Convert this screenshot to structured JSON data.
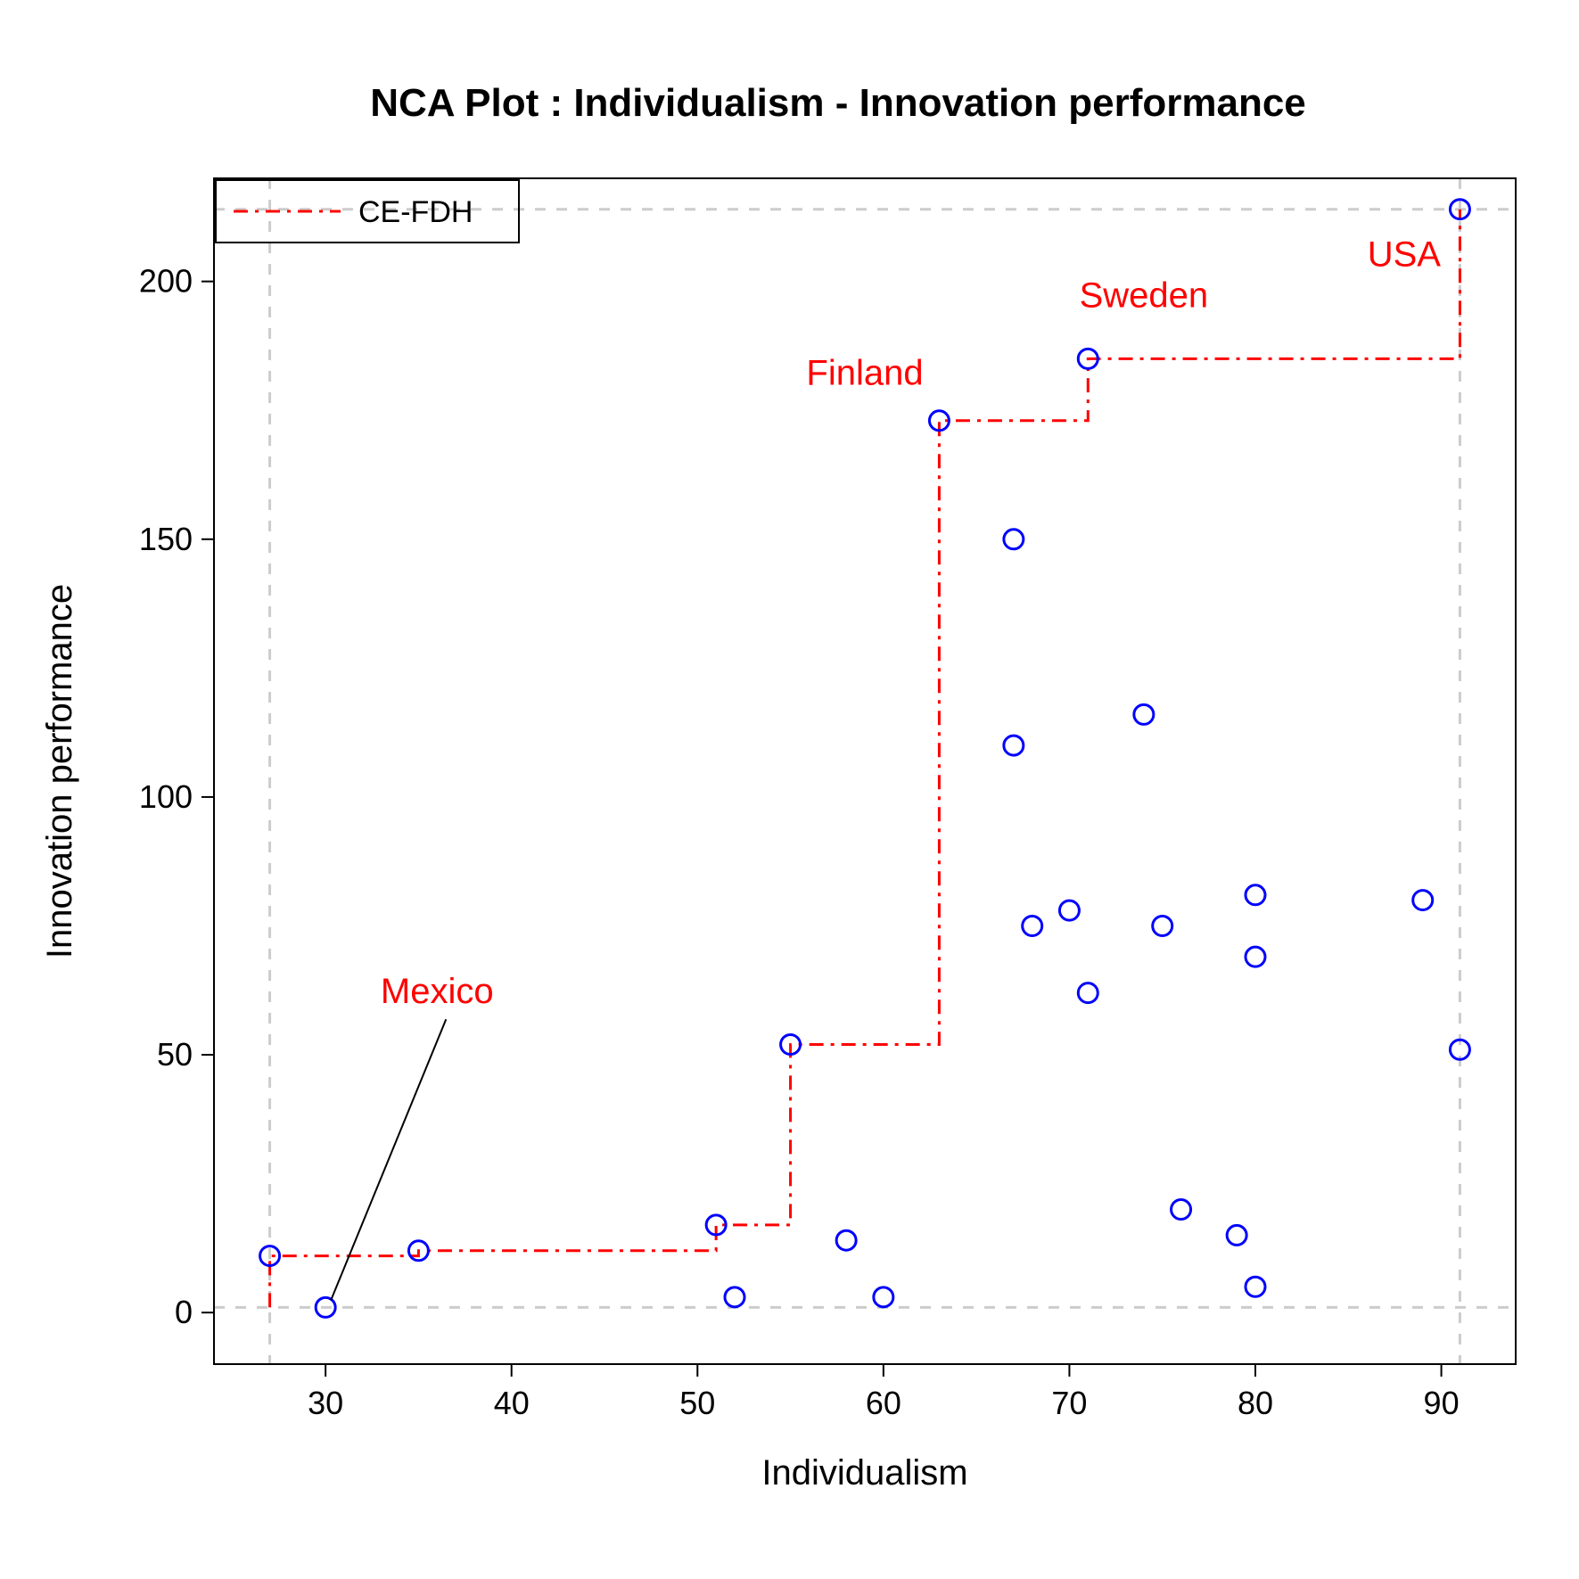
{
  "chart_data": {
    "type": "scatter",
    "title": "NCA Plot : Individualism - Innovation performance",
    "xlabel": "Individualism",
    "ylabel": "Innovation performance",
    "xlim": [
      24,
      94
    ],
    "ylim": [
      -10,
      220
    ],
    "xticks": [
      30,
      40,
      50,
      60,
      70,
      80,
      90
    ],
    "yticks": [
      0,
      50,
      100,
      150,
      200
    ],
    "grid_v": [
      27,
      91
    ],
    "grid_h": [
      1,
      214
    ],
    "points": [
      {
        "x": 27,
        "y": 11
      },
      {
        "x": 30,
        "y": 1
      },
      {
        "x": 35,
        "y": 12
      },
      {
        "x": 51,
        "y": 17
      },
      {
        "x": 52,
        "y": 3
      },
      {
        "x": 55,
        "y": 52
      },
      {
        "x": 58,
        "y": 14
      },
      {
        "x": 60,
        "y": 3
      },
      {
        "x": 63,
        "y": 173
      },
      {
        "x": 67,
        "y": 150
      },
      {
        "x": 67,
        "y": 110
      },
      {
        "x": 68,
        "y": 75
      },
      {
        "x": 70,
        "y": 78
      },
      {
        "x": 71,
        "y": 62
      },
      {
        "x": 71,
        "y": 185
      },
      {
        "x": 74,
        "y": 116
      },
      {
        "x": 75,
        "y": 75
      },
      {
        "x": 76,
        "y": 20
      },
      {
        "x": 79,
        "y": 15
      },
      {
        "x": 80,
        "y": 81
      },
      {
        "x": 80,
        "y": 69
      },
      {
        "x": 80,
        "y": 5
      },
      {
        "x": 89,
        "y": 80
      },
      {
        "x": 91,
        "y": 51
      },
      {
        "x": 91,
        "y": 214
      }
    ],
    "step_line": [
      {
        "x": 27,
        "y": 1
      },
      {
        "x": 27,
        "y": 11
      },
      {
        "x": 35,
        "y": 11
      },
      {
        "x": 35,
        "y": 12
      },
      {
        "x": 51,
        "y": 12
      },
      {
        "x": 51,
        "y": 17
      },
      {
        "x": 55,
        "y": 17
      },
      {
        "x": 55,
        "y": 52
      },
      {
        "x": 63,
        "y": 52
      },
      {
        "x": 63,
        "y": 173
      },
      {
        "x": 71,
        "y": 173
      },
      {
        "x": 71,
        "y": 185
      },
      {
        "x": 91,
        "y": 185
      },
      {
        "x": 91,
        "y": 214
      }
    ],
    "annotations": [
      {
        "label": "Mexico",
        "lx": 36,
        "ly": 60,
        "leader_to": {
          "x": 30,
          "y": 1
        }
      },
      {
        "label": "Finland",
        "lx": 59,
        "ly": 180
      },
      {
        "label": "Sweden",
        "lx": 74,
        "ly": 195
      },
      {
        "label": "USA",
        "lx": 88,
        "ly": 203
      }
    ],
    "legend": {
      "label": "CE-FDH"
    }
  },
  "colors": {
    "point_stroke": "#0000ff",
    "line": "#ff0000",
    "grid": "#cccccc"
  }
}
